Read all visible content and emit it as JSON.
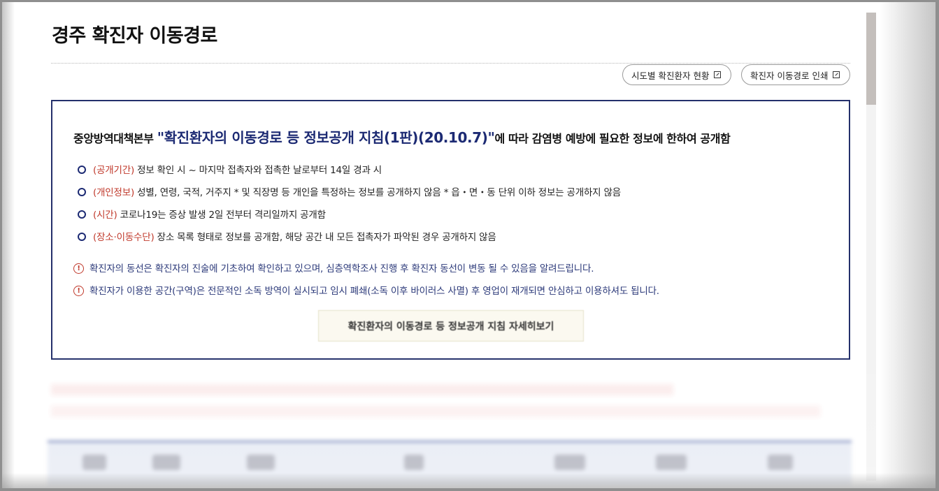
{
  "page": {
    "title": "경주 확진자 이동경로"
  },
  "actions": {
    "status_button": "시도별 확진환자 현황",
    "print_button": "확진자 이동경로 인쇄"
  },
  "notice": {
    "head_prefix": "중앙방역대책본부 ",
    "head_quote": "\"확진환자의 이동경로 등 정보공개 지침(1판)(20.10.7)\"",
    "head_suffix": "에 따라 감염병 예방에 필요한 정보에 한하여 공개함",
    "bullets": [
      {
        "tag": "(공개기간)",
        "text": " 정보 확인 시 ~ 마지막 접촉자와 접촉한 날로부터 14일 경과 시"
      },
      {
        "tag": "(개인정보)",
        "text": " 성별, 연령, 국적, 거주지 * 및 직장명 등 개인을 특정하는 정보를 공개하지 않음 * 읍・면・동 단위 이하 정보는 공개하지 않음"
      },
      {
        "tag": "(시간)",
        "text": " 코로나19는 증상 발생 2일 전부터 격리일까지 공개함"
      },
      {
        "tag": "(장소·이동수단)",
        "text": " 장소 목록 형태로 정보를 공개함, 해당 공간 내 모든 접촉자가 파악된 경우 공개하지 않음"
      }
    ],
    "warnings": [
      "확진자의 동선은 확진자의 진술에 기초하여 확인하고 있으며, 심층역학조사 진행 후 확진자 동선이 변동 될 수 있음을 알려드립니다.",
      "확진자가 이용한 공간(구역)은 전문적인 소독 방역이 실시되고 임시 폐쇄(소독 이후 바이러스 사멸) 후 영업이 재개되면 안심하고 이용하셔도 됩니다."
    ],
    "detail_button": "확진환자의 이동경로 등 정보공개 지침 자세히보기"
  },
  "colors": {
    "accent_navy": "#1c2a73",
    "tag_red": "#c0392b",
    "blurred_notice_red": "#e05656"
  }
}
